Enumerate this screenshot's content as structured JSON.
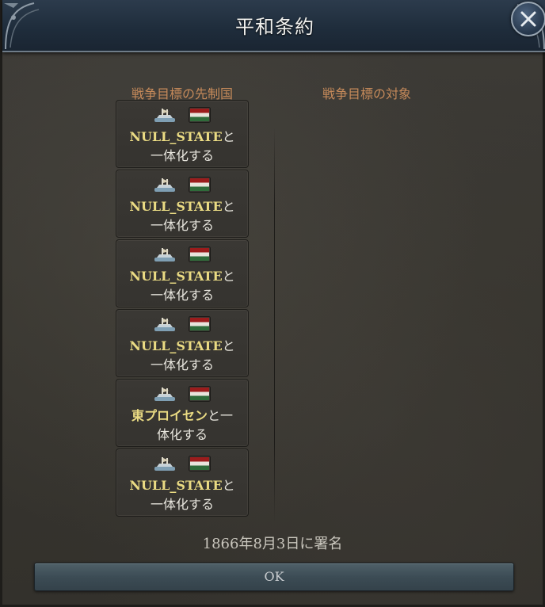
{
  "window": {
    "title": "平和条約"
  },
  "columns": {
    "left_header": "戦争目標の先制国",
    "right_header": "戦争目標の対象"
  },
  "goals": [
    {
      "state": "NULL_STATE",
      "suffix": "と",
      "line2": "一体化する",
      "ship_icon": "ship-icon",
      "flag_icon": "flag-icon"
    },
    {
      "state": "NULL_STATE",
      "suffix": "と",
      "line2": "一体化する",
      "ship_icon": "ship-icon",
      "flag_icon": "flag-icon"
    },
    {
      "state": "NULL_STATE",
      "suffix": "と",
      "line2": "一体化する",
      "ship_icon": "ship-icon",
      "flag_icon": "flag-icon"
    },
    {
      "state": "NULL_STATE",
      "suffix": "と",
      "line2": "一体化する",
      "ship_icon": "ship-icon",
      "flag_icon": "flag-icon"
    },
    {
      "state": "東プロイセン",
      "suffix": "と一",
      "line2": "体化する",
      "ship_icon": "ship-icon",
      "flag_icon": "flag-icon"
    },
    {
      "state": "NULL_STATE",
      "suffix": "と",
      "line2": "一体化する",
      "ship_icon": "ship-icon",
      "flag_icon": "flag-icon"
    }
  ],
  "footer": {
    "signed_text": "1866年8月3日に署名",
    "ok_label": "OK"
  },
  "colors": {
    "title_bar": "#1f2d3c",
    "header_text": "#c68a5a",
    "state_text": "#eadb83",
    "flag_red": "#9b1c1c",
    "flag_green": "#2f6b3a"
  }
}
